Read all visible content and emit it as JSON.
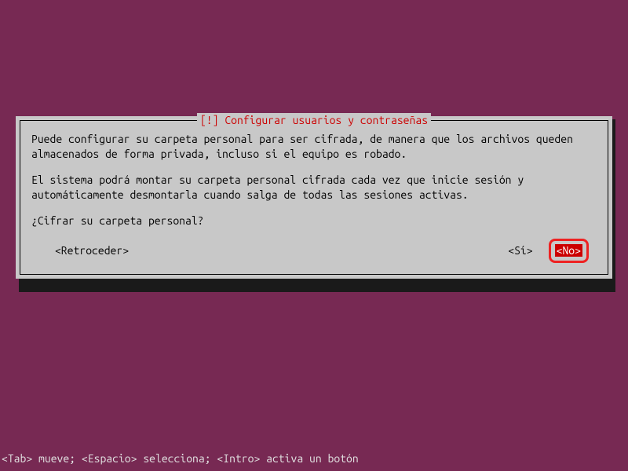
{
  "dialog": {
    "title": " [!] Configurar usuarios y contraseñas ",
    "paragraph1": "Puede configurar su carpeta personal para ser cifrada, de manera que los archivos queden almacenados de forma privada, incluso si el equipo es robado.",
    "paragraph2": "El sistema podrá montar su carpeta personal cifrada cada vez que inicie sesión y automáticamente desmontarla cuando salga de todas las sesiones activas.",
    "question": "¿Cifrar su carpeta personal?",
    "buttons": {
      "back": "<Retroceder>",
      "yes": "<Sí>",
      "no": "<No>"
    }
  },
  "helpbar": "<Tab> mueve; <Espacio> selecciona; <Intro> activa un botón"
}
